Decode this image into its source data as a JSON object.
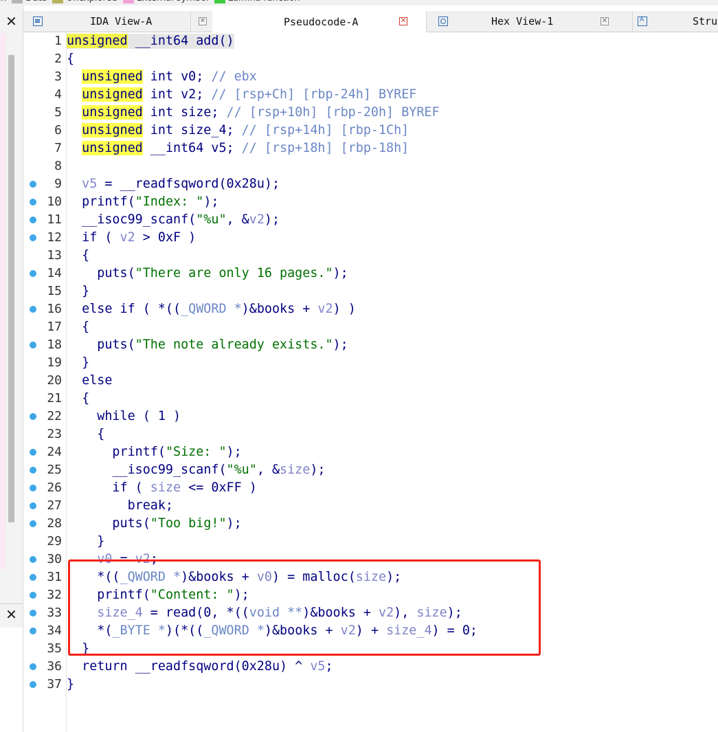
{
  "legend": {
    "items": [
      {
        "label": "ch",
        "color": "#f0f0f0"
      },
      {
        "label": "Data",
        "color": "#b4b4b4"
      },
      {
        "label": "Unexplored",
        "color": "#b6b05a"
      },
      {
        "label": "External symbol",
        "color": "#f2a0d8"
      },
      {
        "label": "Lumina function",
        "color": "#3ecb3e"
      }
    ]
  },
  "left_panel": {
    "close_symbol": "✕"
  },
  "tabs": [
    {
      "label": "IDA View-A",
      "icon": "listing-icon",
      "active": false
    },
    {
      "label": "Pseudocode-A",
      "icon": "none",
      "active": true
    },
    {
      "label": "Hex View-1",
      "icon": "hex-icon",
      "active": false
    },
    {
      "label": "Stru",
      "icon": "struct-icon",
      "active": false
    }
  ],
  "tab_close_symbol": "✕",
  "code_lines": [
    {
      "n": "1",
      "bp": false,
      "first": true,
      "parts": [
        [
          "kw0",
          "unsigned"
        ],
        [
          "plain",
          " __int64 add()"
        ]
      ]
    },
    {
      "n": "2",
      "bp": false,
      "parts": [
        [
          "plain",
          "{"
        ]
      ]
    },
    {
      "n": "3",
      "bp": false,
      "parts": [
        [
          "plain",
          "  "
        ],
        [
          "kw",
          "unsigned"
        ],
        [
          "plain",
          " int v0; "
        ],
        [
          "cm",
          "// ebx"
        ]
      ]
    },
    {
      "n": "4",
      "bp": false,
      "parts": [
        [
          "plain",
          "  "
        ],
        [
          "kw",
          "unsigned"
        ],
        [
          "plain",
          " int v2; "
        ],
        [
          "cm",
          "// [rsp+Ch] [rbp-24h] BYREF"
        ]
      ]
    },
    {
      "n": "5",
      "bp": false,
      "parts": [
        [
          "plain",
          "  "
        ],
        [
          "kw",
          "unsigned"
        ],
        [
          "plain",
          " int size; "
        ],
        [
          "cm",
          "// [rsp+10h] [rbp-20h] BYREF"
        ]
      ]
    },
    {
      "n": "6",
      "bp": false,
      "parts": [
        [
          "plain",
          "  "
        ],
        [
          "kw",
          "unsigned"
        ],
        [
          "plain",
          " int size_4; "
        ],
        [
          "cm",
          "// [rsp+14h] [rbp-1Ch]"
        ]
      ]
    },
    {
      "n": "7",
      "bp": false,
      "parts": [
        [
          "plain",
          "  "
        ],
        [
          "kw",
          "unsigned"
        ],
        [
          "plain",
          " __int64 v5; "
        ],
        [
          "cm",
          "// [rsp+18h] [rbp-18h]"
        ]
      ]
    },
    {
      "n": "8",
      "bp": false,
      "parts": [
        [
          "plain",
          ""
        ]
      ]
    },
    {
      "n": "9",
      "bp": true,
      "parts": [
        [
          "plain",
          "  "
        ],
        [
          "var",
          "v5"
        ],
        [
          "plain",
          " = __readfsqword(0x28u);"
        ]
      ]
    },
    {
      "n": "10",
      "bp": true,
      "parts": [
        [
          "plain",
          "  printf("
        ],
        [
          "str",
          "\"Index: \""
        ],
        [
          "plain",
          ");"
        ]
      ]
    },
    {
      "n": "11",
      "bp": true,
      "parts": [
        [
          "plain",
          "  __isoc99_scanf("
        ],
        [
          "str",
          "\"%u\""
        ],
        [
          "plain",
          ", &"
        ],
        [
          "var",
          "v2"
        ],
        [
          "plain",
          ");"
        ]
      ]
    },
    {
      "n": "12",
      "bp": true,
      "parts": [
        [
          "plain",
          "  if ( "
        ],
        [
          "var",
          "v2"
        ],
        [
          "plain",
          " > 0xF )"
        ]
      ]
    },
    {
      "n": "13",
      "bp": false,
      "parts": [
        [
          "plain",
          "  {"
        ]
      ]
    },
    {
      "n": "14",
      "bp": true,
      "parts": [
        [
          "plain",
          "    puts("
        ],
        [
          "str",
          "\"There are only 16 pages.\""
        ],
        [
          "plain",
          ");"
        ]
      ]
    },
    {
      "n": "15",
      "bp": false,
      "parts": [
        [
          "plain",
          "  }"
        ]
      ]
    },
    {
      "n": "16",
      "bp": true,
      "parts": [
        [
          "plain",
          "  else if ( *(("
        ],
        [
          "cm",
          "_QWORD *"
        ],
        [
          "plain",
          ")&books + "
        ],
        [
          "var",
          "v2"
        ],
        [
          "plain",
          ") )"
        ]
      ]
    },
    {
      "n": "17",
      "bp": false,
      "parts": [
        [
          "plain",
          "  {"
        ]
      ]
    },
    {
      "n": "18",
      "bp": true,
      "parts": [
        [
          "plain",
          "    puts("
        ],
        [
          "str",
          "\"The note already exists.\""
        ],
        [
          "plain",
          ");"
        ]
      ]
    },
    {
      "n": "19",
      "bp": false,
      "parts": [
        [
          "plain",
          "  }"
        ]
      ]
    },
    {
      "n": "20",
      "bp": false,
      "parts": [
        [
          "plain",
          "  else"
        ]
      ]
    },
    {
      "n": "21",
      "bp": false,
      "parts": [
        [
          "plain",
          "  {"
        ]
      ]
    },
    {
      "n": "22",
      "bp": true,
      "parts": [
        [
          "plain",
          "    while ( 1 )"
        ]
      ]
    },
    {
      "n": "23",
      "bp": false,
      "parts": [
        [
          "plain",
          "    {"
        ]
      ]
    },
    {
      "n": "24",
      "bp": true,
      "parts": [
        [
          "plain",
          "      printf("
        ],
        [
          "str",
          "\"Size: \""
        ],
        [
          "plain",
          ");"
        ]
      ]
    },
    {
      "n": "25",
      "bp": true,
      "parts": [
        [
          "plain",
          "      __isoc99_scanf("
        ],
        [
          "str",
          "\"%u\""
        ],
        [
          "plain",
          ", &"
        ],
        [
          "var",
          "size"
        ],
        [
          "plain",
          ");"
        ]
      ]
    },
    {
      "n": "26",
      "bp": true,
      "parts": [
        [
          "plain",
          "      if ( "
        ],
        [
          "var",
          "size"
        ],
        [
          "plain",
          " <= 0xFF )"
        ]
      ]
    },
    {
      "n": "27",
      "bp": true,
      "parts": [
        [
          "plain",
          "        break;"
        ]
      ]
    },
    {
      "n": "28",
      "bp": true,
      "parts": [
        [
          "plain",
          "      puts("
        ],
        [
          "str",
          "\"Too big!\""
        ],
        [
          "plain",
          ");"
        ]
      ]
    },
    {
      "n": "29",
      "bp": false,
      "parts": [
        [
          "plain",
          "    }"
        ]
      ]
    },
    {
      "n": "30",
      "bp": true,
      "parts": [
        [
          "plain",
          "    "
        ],
        [
          "var",
          "v0"
        ],
        [
          "plain",
          " = "
        ],
        [
          "var",
          "v2"
        ],
        [
          "plain",
          ";"
        ]
      ]
    },
    {
      "n": "31",
      "bp": true,
      "parts": [
        [
          "plain",
          "    *(("
        ],
        [
          "cm",
          "_QWORD *"
        ],
        [
          "plain",
          ")&books + "
        ],
        [
          "var",
          "v0"
        ],
        [
          "plain",
          ") = malloc("
        ],
        [
          "var",
          "size"
        ],
        [
          "plain",
          ");"
        ]
      ]
    },
    {
      "n": "32",
      "bp": true,
      "parts": [
        [
          "plain",
          "    printf("
        ],
        [
          "str",
          "\"Content: \""
        ],
        [
          "plain",
          ");"
        ]
      ]
    },
    {
      "n": "33",
      "bp": true,
      "parts": [
        [
          "plain",
          "    "
        ],
        [
          "var",
          "size_4"
        ],
        [
          "plain",
          " = read(0, *(("
        ],
        [
          "cm",
          "void **"
        ],
        [
          "plain",
          ")&books + "
        ],
        [
          "var",
          "v2"
        ],
        [
          "plain",
          "), "
        ],
        [
          "var",
          "size"
        ],
        [
          "plain",
          ");"
        ]
      ]
    },
    {
      "n": "34",
      "bp": true,
      "parts": [
        [
          "plain",
          "    *("
        ],
        [
          "cm",
          "_BYTE *"
        ],
        [
          "plain",
          ")(*(("
        ],
        [
          "cm",
          "_QWORD *"
        ],
        [
          "plain",
          ")&books + "
        ],
        [
          "var",
          "v2"
        ],
        [
          "plain",
          ") + "
        ],
        [
          "var",
          "size_4"
        ],
        [
          "plain",
          ") = 0;"
        ]
      ]
    },
    {
      "n": "35",
      "bp": false,
      "parts": [
        [
          "plain",
          "  }"
        ]
      ]
    },
    {
      "n": "36",
      "bp": true,
      "parts": [
        [
          "plain",
          "  return __readfsqword(0x28u) ^ "
        ],
        [
          "var",
          "v5"
        ],
        [
          "plain",
          ";"
        ]
      ]
    },
    {
      "n": "37",
      "bp": true,
      "parts": [
        [
          "plain",
          "}"
        ]
      ]
    }
  ],
  "colors": {
    "keyword_bg": "#ffff4d",
    "code_text": "#000080",
    "comment": "#6b86c6",
    "variable": "#7f82c9",
    "string": "#007000",
    "breakpoint": "#3ea7e8",
    "highlight_box": "#f2231a"
  }
}
